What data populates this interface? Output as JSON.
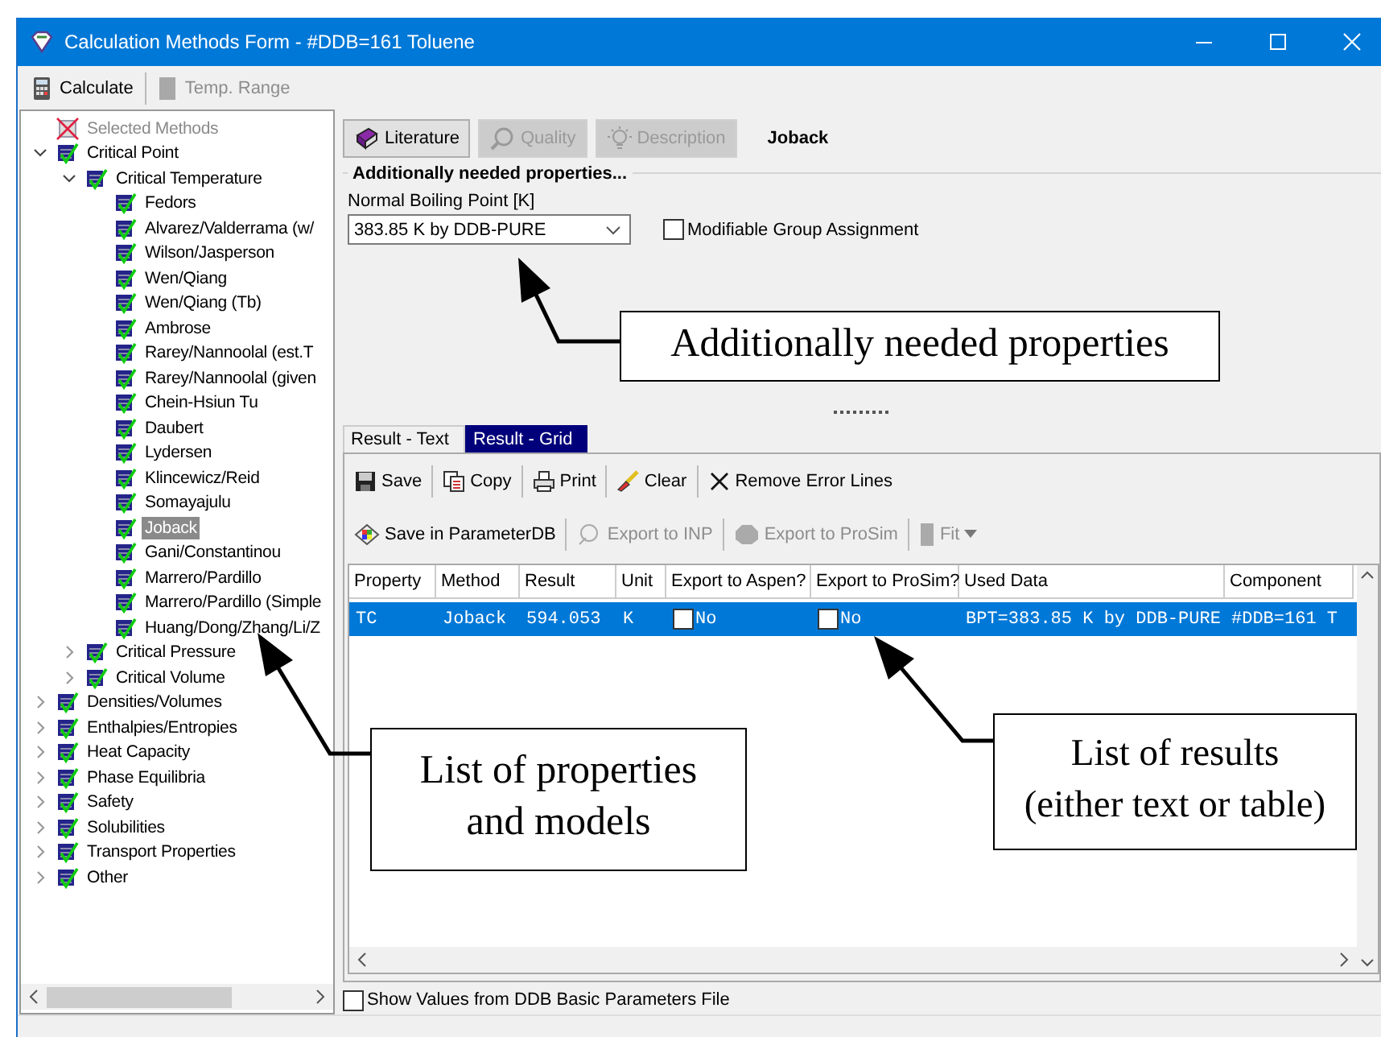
{
  "window": {
    "title": "Calculation Methods Form - #DDB=161 Toluene"
  },
  "toolbar": [
    {
      "label": "Calculate",
      "disabled": false
    },
    {
      "label": "Temp. Range",
      "disabled": true
    }
  ],
  "tree": [
    {
      "label": "Selected Methods",
      "kind": "summary",
      "selected": false
    },
    {
      "label": "Critical Point",
      "kind": "node",
      "selected": false,
      "expanded": true,
      "children": [
        {
          "label": "Critical Temperature",
          "selected": false,
          "expanded": true,
          "children": [
            {
              "label": "Fedors",
              "selected": false
            },
            {
              "label": "Alvarez/Valderrama (w/",
              "selected": false
            },
            {
              "label": "Wilson/Jasperson",
              "selected": false
            },
            {
              "label": "Wen/Qiang",
              "selected": false
            },
            {
              "label": "Wen/Qiang (Tb)",
              "selected": false
            },
            {
              "label": "Ambrose",
              "selected": false
            },
            {
              "label": "Rarey/Nannoolal (est.T",
              "selected": false
            },
            {
              "label": "Rarey/Nannoolal (given",
              "selected": false
            },
            {
              "label": "Chein-Hsiun Tu",
              "selected": false
            },
            {
              "label": "Daubert",
              "selected": false
            },
            {
              "label": "Lydersen",
              "selected": false
            },
            {
              "label": "Klincewicz/Reid",
              "selected": false
            },
            {
              "label": "Somayajulu",
              "selected": false
            },
            {
              "label": "Joback",
              "selected": true
            },
            {
              "label": "Gani/Constantinou",
              "selected": false
            },
            {
              "label": "Marrero/Pardillo",
              "selected": false
            },
            {
              "label": "Marrero/Pardillo (Simple",
              "selected": false
            },
            {
              "label": "Huang/Dong/Zhang/Li/Z",
              "selected": false
            }
          ]
        },
        {
          "label": "Critical Pressure",
          "selected": false,
          "expanded": false
        },
        {
          "label": "Critical Volume",
          "selected": false,
          "expanded": false
        }
      ]
    },
    {
      "label": "Densities/Volumes",
      "kind": "node",
      "selected": false,
      "expanded": false
    },
    {
      "label": "Enthalpies/Entropies",
      "kind": "node",
      "selected": false,
      "expanded": false
    },
    {
      "label": "Heat Capacity",
      "kind": "node",
      "selected": false,
      "expanded": false
    },
    {
      "label": "Phase Equilibria",
      "kind": "node",
      "selected": false,
      "expanded": false
    },
    {
      "label": "Safety",
      "kind": "node",
      "selected": false,
      "expanded": false
    },
    {
      "label": "Solubilities",
      "kind": "node",
      "selected": false,
      "expanded": false
    },
    {
      "label": "Transport Properties",
      "kind": "node",
      "selected": false,
      "expanded": false
    },
    {
      "label": "Other",
      "kind": "node",
      "selected": false,
      "expanded": false
    }
  ],
  "method_buttons": [
    {
      "label": "Literature",
      "disabled": false
    },
    {
      "label": "Quality",
      "disabled": true
    },
    {
      "label": "Description",
      "disabled": true
    }
  ],
  "method_name": "Joback",
  "group_title": "Additionally needed properties...",
  "boiling_point": {
    "label": "Normal Boiling Point [K]",
    "value": "383.85 K by DDB-PURE"
  },
  "modifiable_group": {
    "label": "Modifiable Group Assignment",
    "checked": false
  },
  "result_tabs": [
    {
      "label": "Result - Text",
      "selected": false
    },
    {
      "label": "Result - Grid",
      "selected": true
    }
  ],
  "result_toolbar": [
    {
      "label": "Save",
      "disabled": false
    },
    {
      "label": "Copy",
      "disabled": false
    },
    {
      "label": "Print",
      "disabled": false
    },
    {
      "label": "Clear",
      "disabled": false
    },
    {
      "label": "Remove Error Lines",
      "disabled": false
    }
  ],
  "export_toolbar": [
    {
      "label": "Save in ParameterDB",
      "disabled": false
    },
    {
      "label": "Export to INP",
      "disabled": true
    },
    {
      "label": "Export to ProSim",
      "disabled": true
    },
    {
      "label": "Fit",
      "disabled": true
    }
  ],
  "grid": {
    "columns": [
      "Property",
      "Method",
      "Result",
      "Unit",
      "Export to Aspen?",
      "Export to ProSim?",
      "Used Data",
      "Component"
    ],
    "rows": [
      {
        "selected": true,
        "cells": [
          "TC",
          "Joback",
          "594.053",
          "K",
          {
            "checked": false,
            "label": "No"
          },
          {
            "checked": false,
            "label": "No"
          },
          "BPT=383.85 K by DDB-PURE",
          "#DDB=161 T"
        ]
      }
    ]
  },
  "show_values": {
    "label": "Show Values from DDB Basic Parameters File",
    "checked": false
  },
  "annotations": [
    {
      "text": "Additionally needed properties"
    },
    {
      "text": "List of properties\nand models"
    },
    {
      "text": "List of results\n(either text or table)"
    }
  ]
}
